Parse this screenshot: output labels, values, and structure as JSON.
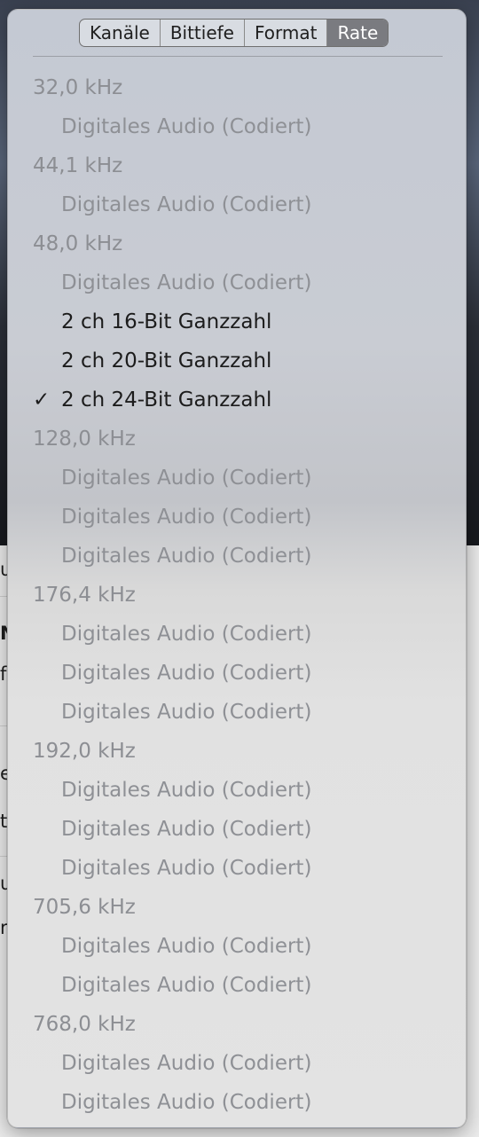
{
  "tabs": [
    {
      "label": "Kanäle",
      "active": false
    },
    {
      "label": "Bittiefe",
      "active": false
    },
    {
      "label": "Format",
      "active": false
    },
    {
      "label": "Rate",
      "active": true
    }
  ],
  "check_glyph": "✓",
  "rates": [
    {
      "label": "32,0 kHz",
      "items": [
        {
          "label": "Digitales Audio (Codiert)",
          "enabled": false
        }
      ]
    },
    {
      "label": "44,1 kHz",
      "items": [
        {
          "label": "Digitales Audio (Codiert)",
          "enabled": false
        }
      ]
    },
    {
      "label": "48,0 kHz",
      "items": [
        {
          "label": "Digitales Audio (Codiert)",
          "enabled": false
        },
        {
          "label": "2 ch 16-Bit Ganzzahl",
          "enabled": true
        },
        {
          "label": "2 ch 20-Bit Ganzzahl",
          "enabled": true
        },
        {
          "label": "2 ch 24-Bit Ganzzahl",
          "enabled": true,
          "checked": true
        }
      ]
    },
    {
      "label": "128,0 kHz",
      "items": [
        {
          "label": "Digitales Audio (Codiert)",
          "enabled": false
        },
        {
          "label": "Digitales Audio (Codiert)",
          "enabled": false
        },
        {
          "label": "Digitales Audio (Codiert)",
          "enabled": false
        }
      ]
    },
    {
      "label": "176,4 kHz",
      "items": [
        {
          "label": "Digitales Audio (Codiert)",
          "enabled": false
        },
        {
          "label": "Digitales Audio (Codiert)",
          "enabled": false
        },
        {
          "label": "Digitales Audio (Codiert)",
          "enabled": false
        }
      ]
    },
    {
      "label": "192,0 kHz",
      "items": [
        {
          "label": "Digitales Audio (Codiert)",
          "enabled": false
        },
        {
          "label": "Digitales Audio (Codiert)",
          "enabled": false
        },
        {
          "label": "Digitales Audio (Codiert)",
          "enabled": false
        }
      ]
    },
    {
      "label": "705,6 kHz",
      "items": [
        {
          "label": "Digitales Audio (Codiert)",
          "enabled": false
        },
        {
          "label": "Digitales Audio (Codiert)",
          "enabled": false
        }
      ]
    },
    {
      "label": "768,0 kHz",
      "items": [
        {
          "label": "Digitales Audio (Codiert)",
          "enabled": false
        },
        {
          "label": "Digitales Audio (Codiert)",
          "enabled": false
        }
      ]
    }
  ],
  "background_peeks": [
    "u",
    "N",
    "f",
    "e",
    "t",
    "u",
    "r"
  ]
}
